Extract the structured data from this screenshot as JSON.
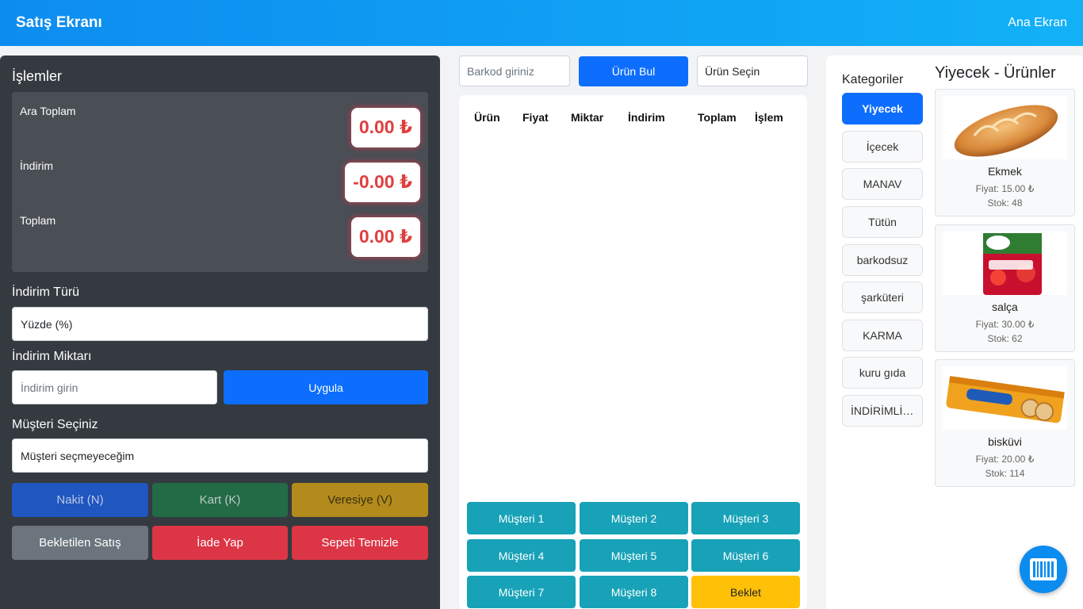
{
  "header": {
    "title": "Satış Ekranı",
    "home_link": "Ana Ekran"
  },
  "left": {
    "title": "İşlemler",
    "totals": {
      "subtotal_label": "Ara Toplam",
      "subtotal_value": "0.00 ₺",
      "discount_label": "İndirim",
      "discount_value": "-0.00 ₺",
      "total_label": "Toplam",
      "total_value": "0.00 ₺"
    },
    "discount_type_label": "İndirim Türü",
    "discount_type_value": "Yüzde (%)",
    "discount_amount_label": "İndirim Miktarı",
    "discount_amount_placeholder": "İndirim girin",
    "apply_label": "Uygula",
    "customer_label": "Müşteri Seçiniz",
    "customer_value": "Müşteri seçmeyeceğim",
    "buttons": {
      "cash": "Nakit (N)",
      "card": "Kart (K)",
      "credit": "Veresiye (V)",
      "held": "Bekletilen Satış",
      "refund": "İade Yap",
      "clear": "Sepeti Temizle"
    },
    "colors": {
      "cash": "#1f56bf",
      "card": "#236b47",
      "credit": "#b38b1c",
      "held": "#6c757d",
      "danger": "#dc3545"
    }
  },
  "middle": {
    "barcode_placeholder": "Barkod giriniz",
    "find_label": "Ürün Bul",
    "select_label": "Ürün Seçin",
    "columns": [
      "Ürün",
      "Fiyat",
      "Miktar",
      "İndirim",
      "Toplam",
      "İşlem"
    ],
    "customers": [
      "Müşteri 1",
      "Müşteri 2",
      "Müşteri 3",
      "Müşteri 4",
      "Müşteri 5",
      "Müşteri 6",
      "Müşteri 7",
      "Müşteri 8"
    ],
    "hold_label": "Beklet"
  },
  "right": {
    "categories_title": "Kategoriler",
    "categories": [
      "Yiyecek",
      "İçecek",
      "MANAV",
      "Tütün",
      "barkodsuz",
      "şarküteri",
      "KARMA",
      "kuru gıda",
      "İNDİRİMLİ ÜRÜNLER"
    ],
    "active_category": "Yiyecek",
    "products_title": "Yiyecek - Ürünler",
    "products": [
      {
        "name": "Ekmek",
        "price": "Fiyat: 15.00 ₺",
        "stock": "Stok: 48",
        "icon": "bread-image"
      },
      {
        "name": "salça",
        "price": "Fiyat: 30.00 ₺",
        "stock": "Stok: 62",
        "icon": "tomato-paste-image"
      },
      {
        "name": "bisküvi",
        "price": "Fiyat: 20.00 ₺",
        "stock": "Stok: 114",
        "icon": "biscuit-image"
      }
    ]
  },
  "fab_icon": "barcode-icon"
}
